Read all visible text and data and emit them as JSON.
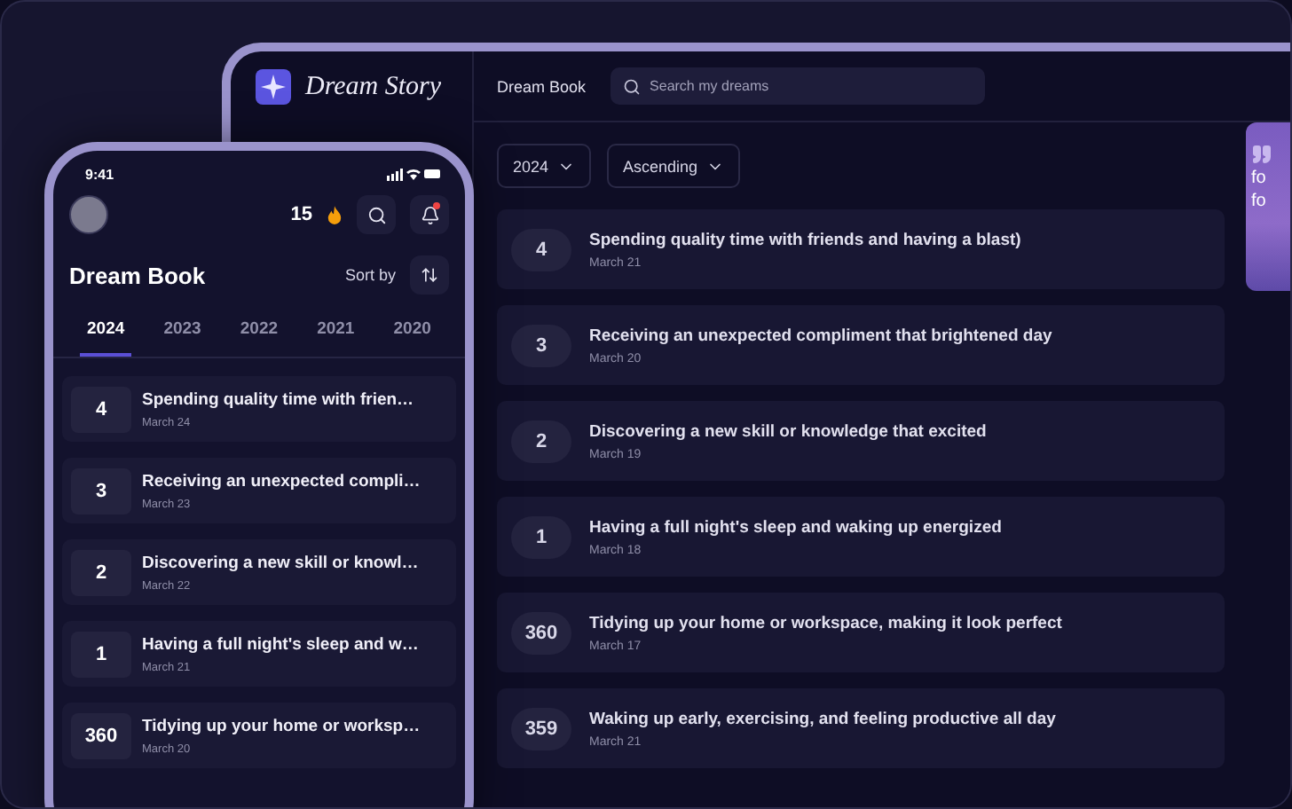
{
  "desktop": {
    "brand": "Dream Story",
    "page_title": "Dream Book",
    "search": {
      "placeholder": "Search my dreams"
    },
    "filters": [
      {
        "label": "2024"
      },
      {
        "label": "Ascending"
      }
    ],
    "entries": [
      {
        "count": "4",
        "title": "Spending quality time with friends and having a blast)",
        "date": "March 21"
      },
      {
        "count": "3",
        "title": "Receiving an unexpected compliment that brightened day",
        "date": "March 20"
      },
      {
        "count": "2",
        "title": "Discovering a new skill or knowledge that excited",
        "date": "March 19"
      },
      {
        "count": "1",
        "title": "Having a full night's sleep and waking up energized",
        "date": "March 18"
      },
      {
        "count": "360",
        "title": "Tidying up your home or workspace, making it look perfect",
        "date": "March 17"
      },
      {
        "count": "359",
        "title": "Waking up early, exercising, and feeling productive all day",
        "date": "March 21"
      }
    ],
    "quote_card": {
      "lines": [
        "fo",
        "fo"
      ]
    }
  },
  "phone": {
    "time": "9:41",
    "streak": "15",
    "notification_unread": true,
    "title": "Dream Book",
    "sort_label": "Sort by",
    "tabs": [
      {
        "label": "2024",
        "selected": true
      },
      {
        "label": "2023",
        "selected": false
      },
      {
        "label": "2022",
        "selected": false
      },
      {
        "label": "2021",
        "selected": false
      },
      {
        "label": "2020",
        "selected": false
      }
    ],
    "entries": [
      {
        "count": "4",
        "title": "Spending quality time with frien…",
        "date": "March 24"
      },
      {
        "count": "3",
        "title": "Receiving an unexpected compli…",
        "date": "March 23"
      },
      {
        "count": "2",
        "title": "Discovering a new skill or knowl…",
        "date": "March 22"
      },
      {
        "count": "1",
        "title": "Having a full night's sleep and w…",
        "date": "March 21"
      },
      {
        "count": "360",
        "title": "Tidying up your home or worksp…",
        "date": "March 20"
      }
    ]
  }
}
